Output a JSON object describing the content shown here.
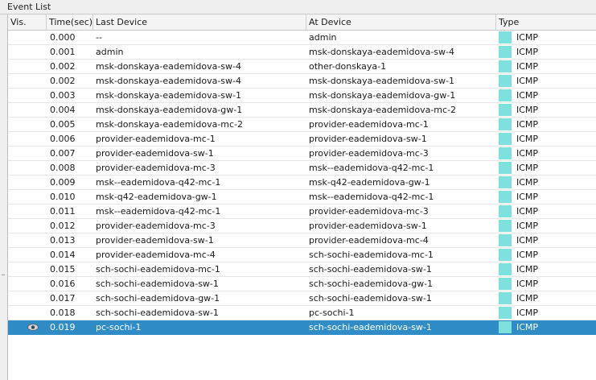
{
  "panel": {
    "title": "Event List"
  },
  "columns": {
    "vis": "Vis.",
    "time": "Time(sec)",
    "last_device": "Last Device",
    "at_device": "At Device",
    "type": "Type"
  },
  "type_color": "#7fe1de",
  "selected_color": "#308cc6",
  "events": [
    {
      "time": "0.000",
      "last": "--",
      "at": "admin",
      "type": "ICMP"
    },
    {
      "time": "0.001",
      "last": "admin",
      "at": "msk-donskaya-eademidova-sw-4",
      "type": "ICMP"
    },
    {
      "time": "0.002",
      "last": "msk-donskaya-eademidova-sw-4",
      "at": "other-donskaya-1",
      "type": "ICMP"
    },
    {
      "time": "0.002",
      "last": "msk-donskaya-eademidova-sw-4",
      "at": "msk-donskaya-eademidova-sw-1",
      "type": "ICMP"
    },
    {
      "time": "0.003",
      "last": "msk-donskaya-eademidova-sw-1",
      "at": "msk-donskaya-eademidova-gw-1",
      "type": "ICMP"
    },
    {
      "time": "0.004",
      "last": "msk-donskaya-eademidova-gw-1",
      "at": "msk-donskaya-eademidova-mc-2",
      "type": "ICMP"
    },
    {
      "time": "0.005",
      "last": "msk-donskaya-eademidova-mc-2",
      "at": "provider-eademidova-mc-1",
      "type": "ICMP"
    },
    {
      "time": "0.006",
      "last": "provider-eademidova-mc-1",
      "at": "provider-eademidova-sw-1",
      "type": "ICMP"
    },
    {
      "time": "0.007",
      "last": "provider-eademidova-sw-1",
      "at": "provider-eademidova-mc-3",
      "type": "ICMP"
    },
    {
      "time": "0.008",
      "last": "provider-eademidova-mc-3",
      "at": "msk--eademidova-q42-mc-1",
      "type": "ICMP"
    },
    {
      "time": "0.009",
      "last": "msk--eademidova-q42-mc-1",
      "at": "msk-q42-eademidova-gw-1",
      "type": "ICMP"
    },
    {
      "time": "0.010",
      "last": "msk-q42-eademidova-gw-1",
      "at": "msk--eademidova-q42-mc-1",
      "type": "ICMP"
    },
    {
      "time": "0.011",
      "last": "msk--eademidova-q42-mc-1",
      "at": "provider-eademidova-mc-3",
      "type": "ICMP"
    },
    {
      "time": "0.012",
      "last": "provider-eademidova-mc-3",
      "at": "provider-eademidova-sw-1",
      "type": "ICMP"
    },
    {
      "time": "0.013",
      "last": "provider-eademidova-sw-1",
      "at": "provider-eademidova-mc-4",
      "type": "ICMP"
    },
    {
      "time": "0.014",
      "last": "provider-eademidova-mc-4",
      "at": "sch-sochi-eademidova-mc-1",
      "type": "ICMP"
    },
    {
      "time": "0.015",
      "last": "sch-sochi-eademidova-mc-1",
      "at": "sch-sochi-eademidova-sw-1",
      "type": "ICMP"
    },
    {
      "time": "0.016",
      "last": "sch-sochi-eademidova-sw-1",
      "at": "sch-sochi-eademidova-gw-1",
      "type": "ICMP"
    },
    {
      "time": "0.017",
      "last": "sch-sochi-eademidova-gw-1",
      "at": "sch-sochi-eademidova-sw-1",
      "type": "ICMP"
    },
    {
      "time": "0.018",
      "last": "sch-sochi-eademidova-sw-1",
      "at": "pc-sochi-1",
      "type": "ICMP"
    },
    {
      "time": "0.019",
      "last": "pc-sochi-1",
      "at": "sch-sochi-eademidova-sw-1",
      "type": "ICMP",
      "selected": true,
      "visible_icon": "eye-icon"
    }
  ]
}
